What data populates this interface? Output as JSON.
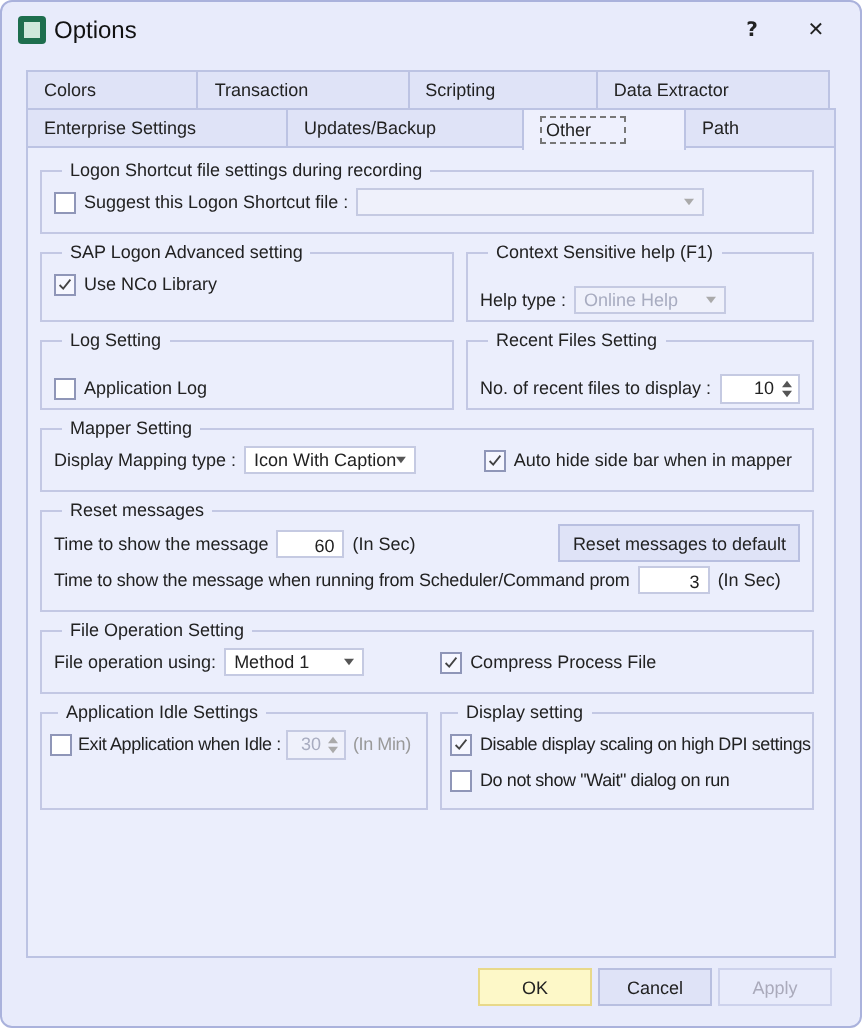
{
  "window": {
    "title": "Options",
    "help": "?",
    "close": "✕"
  },
  "tab_rows": [
    {
      "tabs": [
        {
          "label": "Colors",
          "selected": false
        },
        {
          "label": "Transaction",
          "selected": false
        },
        {
          "label": "Scripting",
          "selected": false
        },
        {
          "label": "Data Extractor",
          "selected": false
        }
      ]
    },
    {
      "tabs": [
        {
          "label": "Enterprise Settings",
          "selected": false
        },
        {
          "label": "Updates/Backup",
          "selected": false
        },
        {
          "label": "Other",
          "selected": true
        },
        {
          "label": "Path",
          "selected": false
        }
      ]
    }
  ],
  "logon_shortcut": {
    "title": "Logon Shortcut file settings during recording",
    "checkbox": {
      "label": "Suggest this Logon Shortcut file :",
      "checked": false
    },
    "dropdown": {
      "disabled": true
    }
  },
  "sap_logon": {
    "title": "SAP Logon Advanced setting",
    "checkbox": {
      "label": "Use NCo Library",
      "checked": true
    }
  },
  "context_help": {
    "title": "Context Sensitive help (F1)",
    "label": "Help type :",
    "dropdown": {
      "value": "Online Help",
      "disabled": true
    }
  },
  "log_setting": {
    "title": "Log Setting",
    "checkbox": {
      "label": "Application Log",
      "checked": false
    }
  },
  "recent_files": {
    "title": "Recent Files Setting",
    "label": "No. of recent files to display :",
    "spinner": {
      "value": "10",
      "disabled": false
    }
  },
  "mapper": {
    "title": "Mapper Setting",
    "label": "Display Mapping type :",
    "dropdown": {
      "value": "Icon With Caption",
      "disabled": false
    },
    "checkbox": {
      "label": "Auto hide side bar when in mapper",
      "checked": true
    }
  },
  "reset_messages": {
    "title": "Reset messages",
    "time_label": "Time to show the message",
    "time_value": "60",
    "time_unit": "(In Sec)",
    "button": "Reset messages to default",
    "scheduler_label": "Time to show the message when running from Scheduler/Command prom",
    "scheduler_value": "3",
    "scheduler_unit": "(In Sec)"
  },
  "file_operation": {
    "title": "File Operation Setting",
    "label": "File operation using:",
    "dropdown": {
      "value": "Method 1",
      "disabled": false
    },
    "checkbox": {
      "label": "Compress Process File",
      "checked": true
    }
  },
  "idle": {
    "title": "Application Idle Settings",
    "checkbox": {
      "label": "Exit Application when Idle :",
      "checked": false
    },
    "spinner": {
      "value": "30",
      "disabled": true
    },
    "unit": "(In Min)"
  },
  "display": {
    "title": "Display setting",
    "checkboxes": [
      {
        "label": "Disable display scaling on high DPI settings",
        "checked": true
      },
      {
        "label": "Do not show \"Wait\" dialog on run",
        "checked": false
      }
    ]
  },
  "buttons": [
    {
      "label": "OK",
      "default": true,
      "disabled": false
    },
    {
      "label": "Cancel",
      "default": false,
      "disabled": false
    },
    {
      "label": "Apply",
      "default": false,
      "disabled": true
    }
  ]
}
